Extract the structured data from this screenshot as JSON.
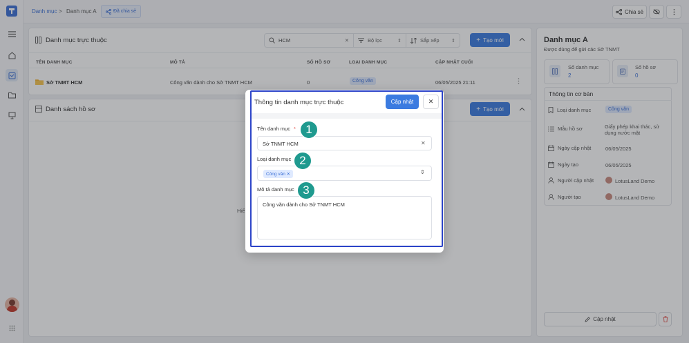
{
  "breadcrumb": {
    "root": "Danh mục",
    "separator": ">",
    "current": "Danh mục A",
    "share_badge": "Đã chia sẻ"
  },
  "topbar": {
    "share_label": "Chia sẻ"
  },
  "sub_panel": {
    "title": "Danh mục trực thuộc",
    "search_value": "HCM",
    "filter_label": "Bộ lọc",
    "sort_label": "Sắp xếp",
    "create_label": "Tạo mới",
    "columns": [
      "TÊN DANH MỤC",
      "MÔ TẢ",
      "SỐ HỒ SƠ",
      "LOẠI DANH MỤC",
      "CẬP NHẬT CUỐI"
    ],
    "rows": [
      {
        "name": "Sở TNMT HCM",
        "description": "Công văn dành cho Sở TNMT HCM",
        "count": "0",
        "type": "Công văn",
        "updated": "06/05/2025 21:11"
      }
    ]
  },
  "records_panel": {
    "title": "Danh sách hồ sơ",
    "create_label": "Tạo mới",
    "empty_fragment": "Hiể"
  },
  "right_panel": {
    "title": "Danh mục A",
    "subtitle": "Được dùng để gửi các Sở TNMT",
    "stat1_label": "Số danh mục",
    "stat1_value": "2",
    "stat2_label": "Số hồ sơ",
    "stat2_value": "0",
    "section_title": "Thông tin cơ bản",
    "rows": [
      {
        "label": "Loại danh mục",
        "value": "Công văn"
      },
      {
        "label": "Mẫu hồ sơ",
        "value": "Giấy phép khai thác, sử dụng nước mặt"
      },
      {
        "label": "Ngày cập nhật",
        "value": "06/05/2025"
      },
      {
        "label": "Ngày tạo",
        "value": "06/05/2025"
      },
      {
        "label": "Người cập nhật",
        "value": "LotusLand Demo"
      },
      {
        "label": "Người tạo",
        "value": "LotusLand Demo"
      }
    ],
    "update_label": "Cập nhật"
  },
  "modal": {
    "title": "Thông tin danh mục trực thuộc",
    "update_label": "Cập nhật",
    "name_label": "Tên danh mục",
    "required_mark": "*",
    "name_value": "Sở TNMT HCM",
    "type_label": "Loại danh mục",
    "type_value": "Công văn",
    "desc_label": "Mô tả danh mục",
    "desc_value": "Công văn dành cho Sở TNMT HCM"
  },
  "markers": [
    "1",
    "2",
    "3"
  ],
  "colors": {
    "accent": "#3b7be0",
    "tag_bg": "#dfeaff",
    "marker": "#1f9a8f",
    "modal_frame": "#2c44c8"
  }
}
